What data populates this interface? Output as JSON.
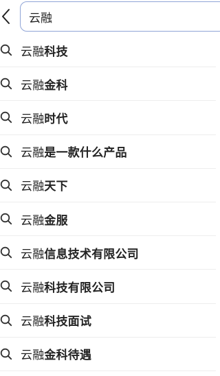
{
  "search": {
    "query": "云融"
  },
  "suggestions": [
    {
      "prefix": "云融",
      "suffix": "科技"
    },
    {
      "prefix": "云融",
      "suffix": "金科"
    },
    {
      "prefix": "云融",
      "suffix": "时代"
    },
    {
      "prefix": "云融",
      "suffix": "是一款什么产品"
    },
    {
      "prefix": "云融",
      "suffix": "天下"
    },
    {
      "prefix": "云融",
      "suffix": "金服"
    },
    {
      "prefix": "云融",
      "suffix": "信息技术有限公司"
    },
    {
      "prefix": "云融",
      "suffix": "科技有限公司"
    },
    {
      "prefix": "云融",
      "suffix": "科技面试"
    },
    {
      "prefix": "云融",
      "suffix": "金科待遇"
    }
  ],
  "icons": {
    "back": "chevron-left-icon",
    "suggestion": "search-icon"
  },
  "colors": {
    "search_border": "#8fa4d6",
    "text": "#222222",
    "divider": "#ededed"
  }
}
